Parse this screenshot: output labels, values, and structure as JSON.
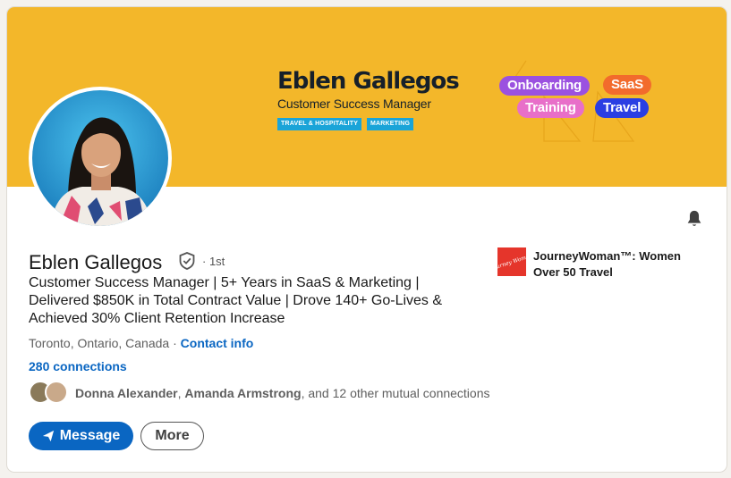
{
  "banner": {
    "name": "Eblen Gallegos",
    "role": "Customer Success Manager",
    "tags": [
      "TRAVEL & HOSPITALITY",
      "MARKETING"
    ],
    "pills": [
      "Onboarding",
      "SaaS",
      "Training",
      "Travel"
    ]
  },
  "profile": {
    "name": "Eblen Gallegos",
    "degree": "· 1st",
    "headline": "Customer Success Manager | 5+ Years in SaaS & Marketing | Delivered $850K in Total Contract Value | Drove 140+ Go-Lives & Achieved 30% Client Retention Increase",
    "location": "Toronto, Ontario, Canada",
    "location_sep": " · ",
    "contact_info": "Contact info",
    "connections": "280 connections",
    "mutual": {
      "first": "Donna Alexander",
      "sep": ", ",
      "second": "Amanda Armstrong",
      "rest": ", and 12 other mutual connections"
    }
  },
  "actions": {
    "message": "Message",
    "more": "More"
  },
  "company": {
    "name": "JourneyWoman™: Women Over 50 Travel",
    "logo_text": "Journey Woman"
  },
  "colors": {
    "banner": "#f3b72a",
    "primary": "#0a66c2",
    "logo": "#e5352b"
  },
  "icons": [
    "verified-icon",
    "bell-icon",
    "send-icon"
  ]
}
